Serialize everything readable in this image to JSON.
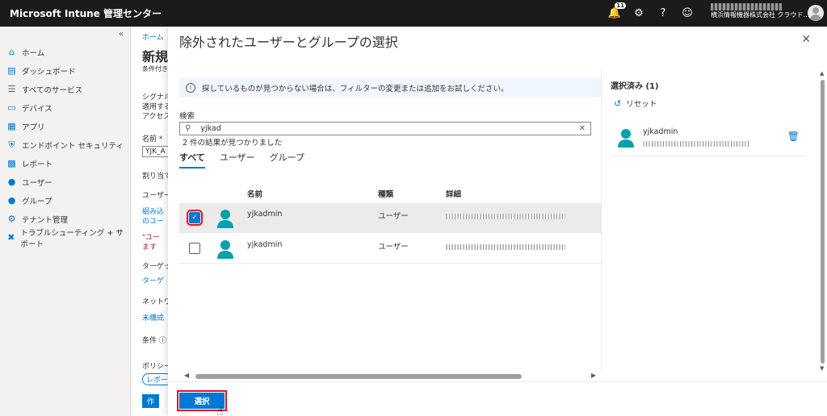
{
  "app": {
    "title": "Microsoft Intune 管理センター"
  },
  "topbar": {
    "notification_count": "11",
    "icons": [
      "bell-icon",
      "gear-icon",
      "help-icon",
      "feedback-icon"
    ],
    "account_org": "横浜情報機器株式会社 クラウド..."
  },
  "sidebar": {
    "items": [
      {
        "label": "ホーム",
        "icon": "home-icon"
      },
      {
        "label": "ダッシュボード",
        "icon": "dashboard-icon"
      },
      {
        "label": "すべてのサービス",
        "icon": "all-services-icon"
      },
      {
        "label": "デバイス",
        "icon": "devices-icon"
      },
      {
        "label": "アプリ",
        "icon": "apps-icon"
      },
      {
        "label": "エンドポイント セキュリティ",
        "icon": "endpoint-security-icon"
      },
      {
        "label": "レポート",
        "icon": "reports-icon"
      },
      {
        "label": "ユーザー",
        "icon": "users-icon"
      },
      {
        "label": "グループ",
        "icon": "groups-icon"
      },
      {
        "label": "テナント管理",
        "icon": "tenant-icon"
      },
      {
        "label": "トラブルシューティング + サポート",
        "icon": "troubleshoot-icon"
      }
    ]
  },
  "background": {
    "breadcrumb": "ホーム",
    "title": "新規",
    "subtitle": "条件付き",
    "lines": [
      "シグナル",
      "適用する",
      "アクセス",
      "名前 *",
      "YJK_A",
      "割り当て",
      "ユーザー",
      "組み込",
      "のユー",
      "\"ユー",
      "ます",
      "ターゲット",
      "ターゲ",
      "ネットワー",
      "未構成",
      "条件 ⓘ",
      "ポリシー",
      "レポー",
      "作"
    ]
  },
  "panel": {
    "title": "除外されたユーザーとグループの選択",
    "info": "探しているものが見つからない場合は、フィルターの変更または追加をお試しください。",
    "search_label": "検索",
    "search_value": "yjkad",
    "result_count": "2 件の結果が見つかりました",
    "tabs": [
      "すべて",
      "ユーザー",
      "グループ"
    ],
    "columns": {
      "name": "名前",
      "type": "種類",
      "detail": "詳細"
    },
    "rows": [
      {
        "name": "yjkadmin",
        "type": "ユーザー",
        "checked": true
      },
      {
        "name": "yjkadmin",
        "type": "ユーザー",
        "checked": false
      }
    ],
    "selected_title": "選択済み (1)",
    "reset_label": "リセット",
    "selected_items": [
      {
        "name": "yjkadmin"
      }
    ],
    "select_button": "選択"
  },
  "colors": {
    "accent": "#0078d4",
    "highlight": "#e81123",
    "topbar": "#1b1b1b"
  }
}
